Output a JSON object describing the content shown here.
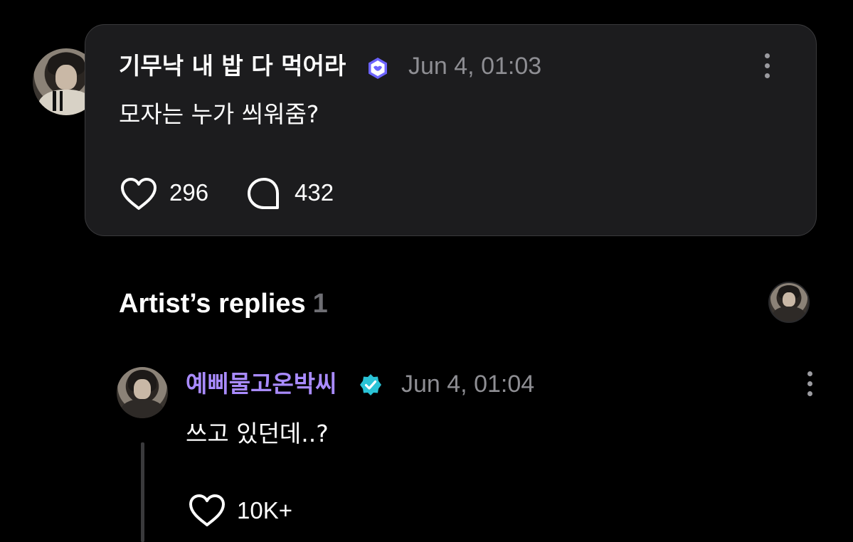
{
  "post": {
    "author": "기무낙 내 밥 다 먹어라",
    "timestamp": "Jun 4, 01:03",
    "text": "모자는 누가 씌워줌?",
    "likes": "296",
    "comments": "432",
    "badge_color": "#6c63ff"
  },
  "replies_section": {
    "title": "Artist’s replies",
    "count": "1"
  },
  "reply": {
    "author": "예삐물고온박씨",
    "author_color": "#a98bff",
    "badge_color": "#2ac3d6",
    "timestamp": "Jun 4, 01:04",
    "text": "쓰고 있던데..?",
    "likes": "10K+"
  }
}
